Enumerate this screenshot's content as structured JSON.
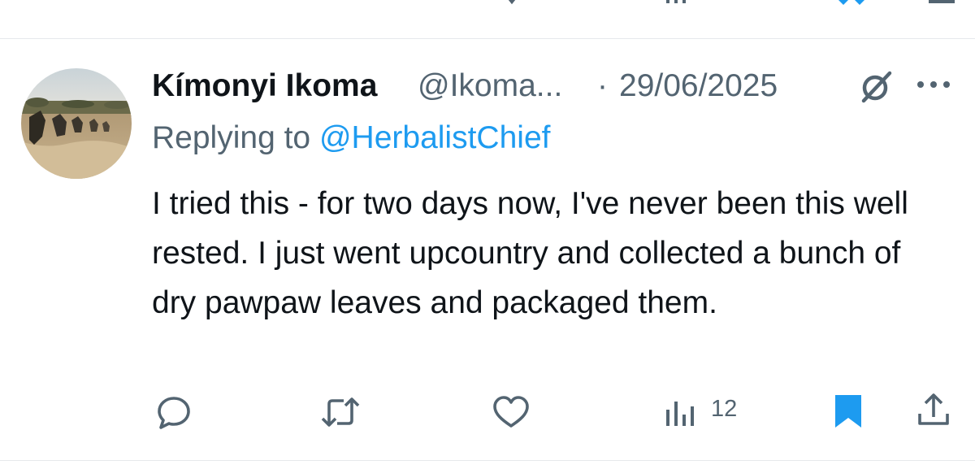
{
  "tweet": {
    "display_name": "Kímonyi Ikoma",
    "handle": "@Ikoma...",
    "separator": "·",
    "date": "29/06/2025",
    "reply_prefix": "Replying to ",
    "reply_to": "@HerbalistChief",
    "text": "I tried this - for two days now, I've never been this well rested. I just went upcountry and collected a bunch of dry pawpaw leaves and packaged them."
  },
  "actions": {
    "reply_icon": "reply-icon",
    "retweet_icon": "retweet-icon",
    "like_icon": "heart-icon",
    "views_icon": "views-icon",
    "views_count": "12",
    "bookmark_icon": "bookmark-icon",
    "share_icon": "share-icon"
  },
  "colors": {
    "text": "#0f1419",
    "secondary": "#536471",
    "accent": "#1d9bf0",
    "divider": "#e6e9ec"
  }
}
